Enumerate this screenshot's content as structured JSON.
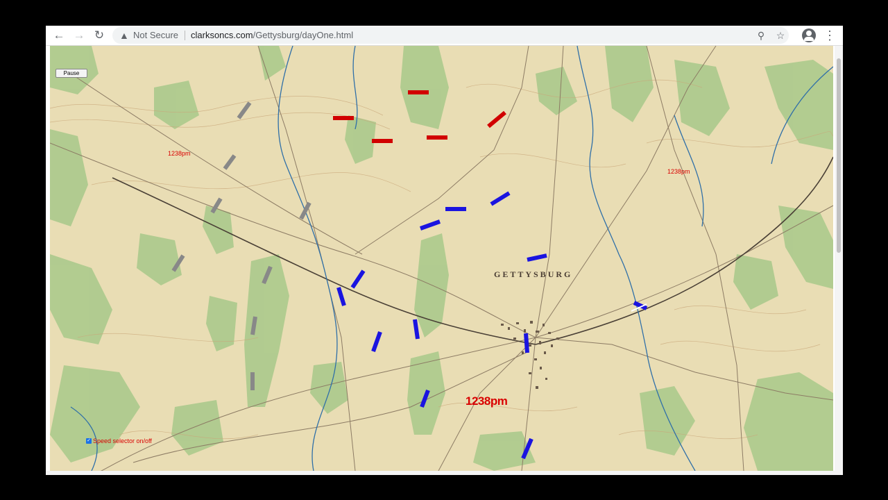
{
  "browser": {
    "security_label": "Not Secure",
    "url_host": "clarksoncs.com",
    "url_path": "/Gettysburg/dayOne.html",
    "icons": {
      "back": "back-arrow-icon",
      "forward": "forward-arrow-icon",
      "reload": "reload-icon",
      "warning": "warning-triangle-icon",
      "zoom": "magnifier-icon",
      "bookmark": "star-icon",
      "account": "account-icon",
      "menu": "three-dots-icon"
    }
  },
  "controls": {
    "pause_label": "Pause",
    "speed_selector_label": "Speed selector on/off",
    "speed_selector_checked": true
  },
  "map": {
    "town_label": "GETTYSBURG",
    "time_labels": [
      "1238pm",
      "1238pm",
      "1238pm"
    ],
    "unit_colors": {
      "confederate": "#d10000",
      "union": "#1a14e0",
      "other": "#888888"
    },
    "unit_counts": {
      "confederate": 6,
      "union": 13,
      "other": 8
    }
  }
}
